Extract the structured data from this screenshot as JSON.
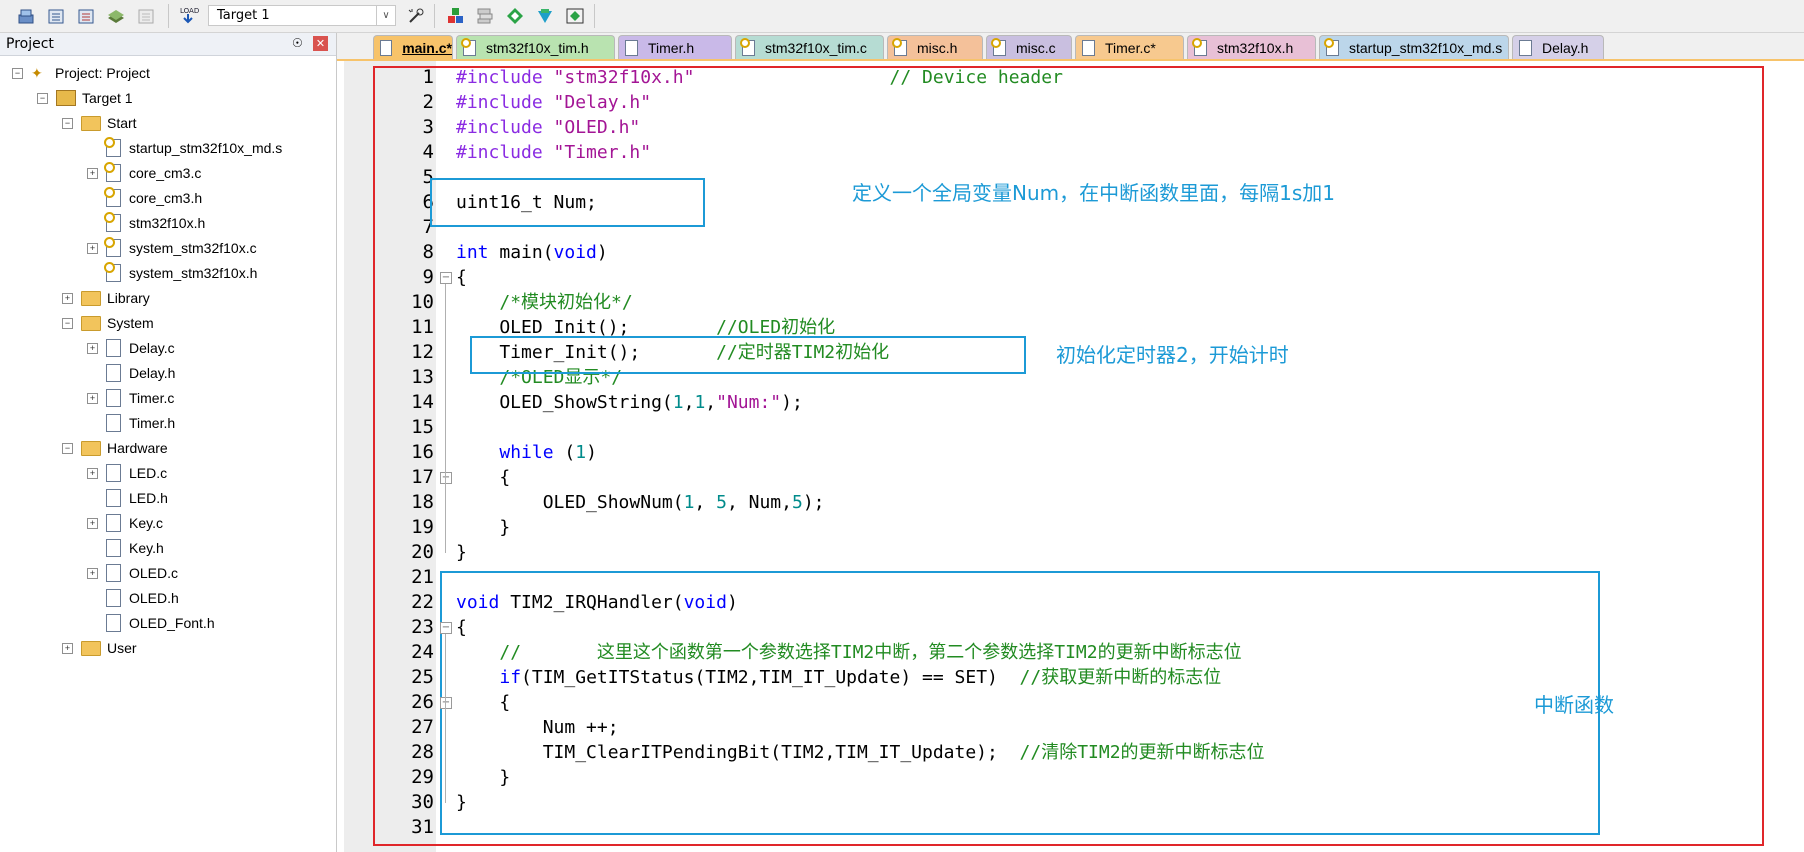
{
  "toolbar": {
    "target": "Target 1",
    "icons": [
      "translate-icon",
      "build-icon",
      "rebuild-icon",
      "batch-build-icon",
      "stop-build-icon",
      "download-icon",
      "options-icon",
      "manage-components-icon",
      "file-extensions-icon",
      "select-packs-icon",
      "pack-installer-icon",
      "debug-icon"
    ]
  },
  "project_panel": {
    "title": "Project",
    "pin": "☉",
    "close": "✕",
    "tree": [
      {
        "label": "Project: Project",
        "type": "project",
        "depth": 0,
        "expander": "-"
      },
      {
        "label": "Target 1",
        "type": "target",
        "depth": 1,
        "expander": "-"
      },
      {
        "label": "Start",
        "type": "folder",
        "depth": 2,
        "expander": "-"
      },
      {
        "label": "startup_stm32f10x_md.s",
        "type": "file-key",
        "depth": 3,
        "expander": ""
      },
      {
        "label": "core_cm3.c",
        "type": "file-key",
        "depth": 3,
        "expander": "+"
      },
      {
        "label": "core_cm3.h",
        "type": "file-key",
        "depth": 3,
        "expander": ""
      },
      {
        "label": "stm32f10x.h",
        "type": "file-key",
        "depth": 3,
        "expander": ""
      },
      {
        "label": "system_stm32f10x.c",
        "type": "file-key",
        "depth": 3,
        "expander": "+"
      },
      {
        "label": "system_stm32f10x.h",
        "type": "file-key",
        "depth": 3,
        "expander": ""
      },
      {
        "label": "Library",
        "type": "folder",
        "depth": 2,
        "expander": "+"
      },
      {
        "label": "System",
        "type": "folder",
        "depth": 2,
        "expander": "-"
      },
      {
        "label": "Delay.c",
        "type": "file",
        "depth": 3,
        "expander": "+"
      },
      {
        "label": "Delay.h",
        "type": "file",
        "depth": 3,
        "expander": ""
      },
      {
        "label": "Timer.c",
        "type": "file",
        "depth": 3,
        "expander": "+"
      },
      {
        "label": "Timer.h",
        "type": "file",
        "depth": 3,
        "expander": ""
      },
      {
        "label": "Hardware",
        "type": "folder",
        "depth": 2,
        "expander": "-"
      },
      {
        "label": "LED.c",
        "type": "file",
        "depth": 3,
        "expander": "+"
      },
      {
        "label": "LED.h",
        "type": "file",
        "depth": 3,
        "expander": ""
      },
      {
        "label": "Key.c",
        "type": "file",
        "depth": 3,
        "expander": "+"
      },
      {
        "label": "Key.h",
        "type": "file",
        "depth": 3,
        "expander": ""
      },
      {
        "label": "OLED.c",
        "type": "file",
        "depth": 3,
        "expander": "+"
      },
      {
        "label": "OLED.h",
        "type": "file",
        "depth": 3,
        "expander": ""
      },
      {
        "label": "OLED_Font.h",
        "type": "file",
        "depth": 3,
        "expander": ""
      },
      {
        "label": "User",
        "type": "folder",
        "depth": 2,
        "expander": "+"
      }
    ]
  },
  "tabs": [
    {
      "label": "main.c*",
      "color": "#f7c36a",
      "active": true,
      "icon": "file"
    },
    {
      "label": "stm32f10x_tim.h",
      "color": "#b9e3b0",
      "active": false,
      "icon": "key"
    },
    {
      "label": "Timer.h",
      "color": "#c9b9e8",
      "active": false,
      "icon": "file"
    },
    {
      "label": "stm32f10x_tim.c",
      "color": "#b6dcd3",
      "active": false,
      "icon": "key"
    },
    {
      "label": "misc.h",
      "color": "#f4c19a",
      "active": false,
      "icon": "key"
    },
    {
      "label": "misc.c",
      "color": "#c9bfe0",
      "active": false,
      "icon": "key"
    },
    {
      "label": "Timer.c*",
      "color": "#f7c98f",
      "active": false,
      "icon": "file"
    },
    {
      "label": "stm32f10x.h",
      "color": "#e8c0d6",
      "active": false,
      "icon": "key"
    },
    {
      "label": "startup_stm32f10x_md.s",
      "color": "#bcd6ea",
      "active": false,
      "icon": "key"
    },
    {
      "label": "Delay.h",
      "color": "#d5d0e8",
      "active": false,
      "icon": "file"
    }
  ],
  "code_lines": [
    [
      [
        "pp",
        "#include "
      ],
      [
        "str",
        "\"stm32f10x.h\""
      ],
      [
        "",
        "                  "
      ],
      [
        "cm",
        "// Device header"
      ]
    ],
    [
      [
        "pp",
        "#include "
      ],
      [
        "str",
        "\"Delay.h\""
      ]
    ],
    [
      [
        "pp",
        "#include "
      ],
      [
        "str",
        "\"OLED.h\""
      ]
    ],
    [
      [
        "pp",
        "#include "
      ],
      [
        "str",
        "\"Timer.h\""
      ]
    ],
    [],
    [
      [
        "",
        "uint16_t Num;"
      ]
    ],
    [],
    [
      [
        "kw",
        "int"
      ],
      [
        "",
        " main("
      ],
      [
        "kw",
        "void"
      ],
      [
        "",
        ")"
      ]
    ],
    [
      [
        "",
        "{"
      ]
    ],
    [
      [
        "",
        "    "
      ],
      [
        "cm",
        "/*模块初始化*/"
      ]
    ],
    [
      [
        "",
        "    OLED_Init();        "
      ],
      [
        "cm",
        "//OLED初始化"
      ]
    ],
    [
      [
        "",
        "    Timer_Init();       "
      ],
      [
        "cm",
        "//定时器TIM2初始化"
      ]
    ],
    [
      [
        "",
        "    "
      ],
      [
        "cm",
        "/*OLED显示*/"
      ]
    ],
    [
      [
        "",
        "    OLED_ShowString("
      ],
      [
        "num",
        "1"
      ],
      [
        "",
        ","
      ],
      [
        "num",
        "1"
      ],
      [
        "",
        ","
      ],
      [
        "str",
        "\"Num:\""
      ],
      [
        "",
        ");"
      ]
    ],
    [],
    [
      [
        "",
        "    "
      ],
      [
        "kw",
        "while"
      ],
      [
        "",
        " ("
      ],
      [
        "num",
        "1"
      ],
      [
        "",
        ")"
      ]
    ],
    [
      [
        "",
        "    {"
      ]
    ],
    [
      [
        "",
        "        OLED_ShowNum("
      ],
      [
        "num",
        "1"
      ],
      [
        "",
        ", "
      ],
      [
        "num",
        "5"
      ],
      [
        "",
        ", Num,"
      ],
      [
        "num",
        "5"
      ],
      [
        "",
        ");"
      ]
    ],
    [
      [
        "",
        "    }"
      ]
    ],
    [
      [
        "",
        "}"
      ]
    ],
    [],
    [
      [
        "kw",
        "void"
      ],
      [
        "",
        " TIM2_IRQHandler("
      ],
      [
        "kw",
        "void"
      ],
      [
        "",
        ")"
      ]
    ],
    [
      [
        "",
        "{"
      ]
    ],
    [
      [
        "",
        "    "
      ],
      [
        "cm",
        "//       这里这个函数第一个参数选择TIM2中断，第二个参数选择TIM2的更新中断标志位"
      ]
    ],
    [
      [
        "",
        "    "
      ],
      [
        "kw",
        "if"
      ],
      [
        "",
        "(TIM_GetITStatus(TIM2,TIM_IT_Update) == SET)  "
      ],
      [
        "cm",
        "//获取更新中断的标志位"
      ]
    ],
    [
      [
        "",
        "    {"
      ]
    ],
    [
      [
        "",
        "        Num ++;"
      ]
    ],
    [
      [
        "",
        "        TIM_ClearITPendingBit(TIM2,TIM_IT_Update);  "
      ],
      [
        "cm",
        "//清除TIM2的更新中断标志位"
      ]
    ],
    [
      [
        "",
        "    }"
      ]
    ],
    [
      [
        "",
        "}"
      ]
    ],
    []
  ],
  "annotations": {
    "note1": "定义一个全局变量Num，在中断函数里面，每隔1s加1",
    "note2": "初始化定时器2，开始计时",
    "note3": "中断函数"
  }
}
